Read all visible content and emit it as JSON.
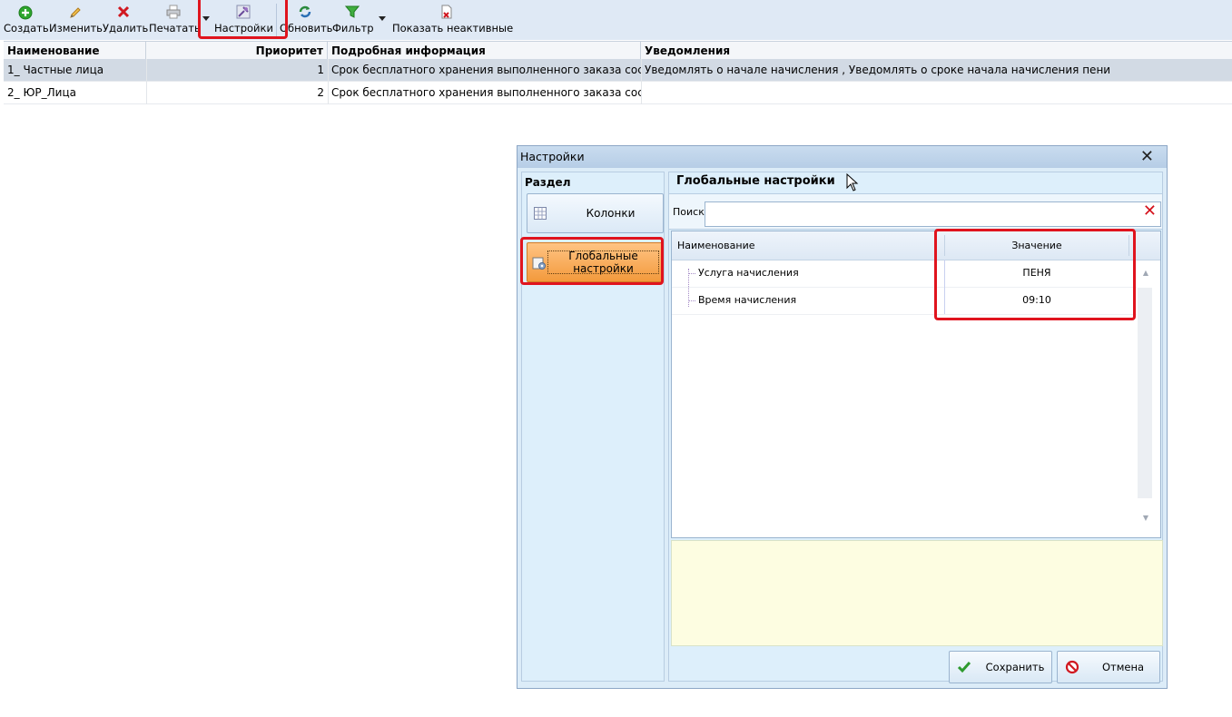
{
  "toolbar": {
    "create": "Создать",
    "edit": "Изменить",
    "delete": "Удалить",
    "print": "Печатать",
    "settings": "Настройки",
    "refresh": "Обновить",
    "filter": "Фильтр",
    "show_inactive": "Показать неактивные"
  },
  "grid": {
    "columns": [
      "Наименование",
      "Приоритет",
      "Подробная информация",
      "Уведомления"
    ],
    "rows": [
      {
        "name": "1_ Частные лица",
        "priority": "1",
        "details": "Срок бесплатного хранения выполненного заказа сос",
        "notifications": "Уведомлять о начале начисления , Уведомлять о сроке начала начисления пени"
      },
      {
        "name": "2_ ЮР_Лица",
        "priority": "2",
        "details": "Срок бесплатного хранения выполненного заказа сос",
        "notifications": ""
      }
    ]
  },
  "dialog": {
    "title": "Настройки",
    "section_label": "Раздел",
    "nav": {
      "columns": "Колонки",
      "global": "Глобальные настройки"
    },
    "panel_title": "Глобальные настройки",
    "search": {
      "label": "Поиск",
      "value": ""
    },
    "tree": {
      "columns": {
        "name": "Наименование",
        "value": "Значение"
      },
      "rows": [
        {
          "name": "Услуга начисления",
          "value": "ПЕНЯ"
        },
        {
          "name": "Время начисления",
          "value": "09:10"
        }
      ]
    },
    "buttons": {
      "save": "Сохранить",
      "cancel": "Отмена"
    }
  },
  "colors": {
    "highlight": "#e0141e",
    "active_nav": "#f39a3c",
    "selected_row": "#d2dae4"
  }
}
